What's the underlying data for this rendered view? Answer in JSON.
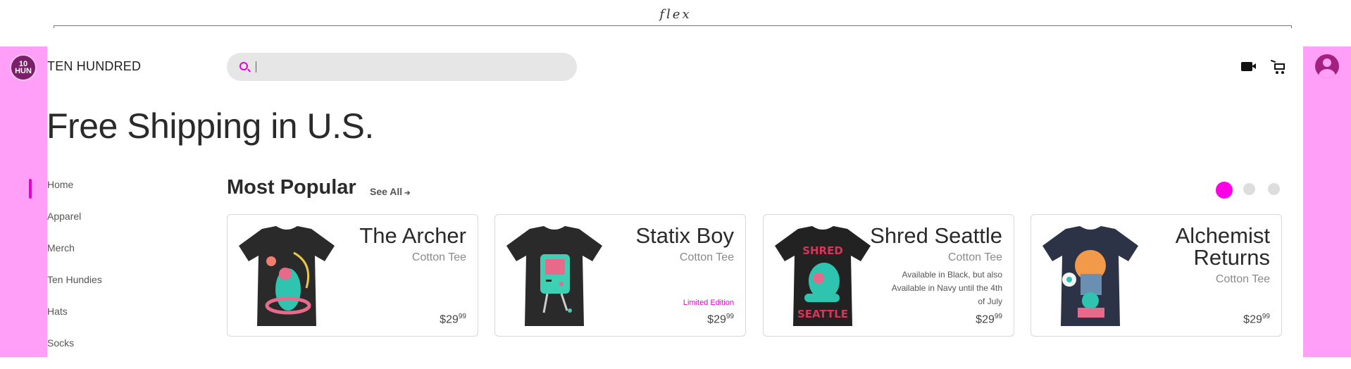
{
  "frame": {
    "label": "flex"
  },
  "brand": {
    "logo_text": "10 HUN",
    "name": "TEN HUNDRED"
  },
  "search": {
    "value": "",
    "placeholder": ""
  },
  "headline": "Free Shipping in U.S.",
  "nav": {
    "items": [
      "Home",
      "Apparel",
      "Merch",
      "Ten Hundies",
      "Hats",
      "Socks"
    ],
    "active": "Home"
  },
  "section": {
    "title": "Most Popular",
    "see_all": "See All",
    "carousel_pages": 3,
    "carousel_active": 1
  },
  "colors": {
    "accent": "#ff00e6",
    "side_panel": "#ff9ff8"
  },
  "icons": {
    "video": "video-icon",
    "cart": "cart-icon",
    "avatar": "avatar-icon",
    "search": "search-icon"
  },
  "products": [
    {
      "name": "The Archer",
      "type": "Cotton Tee",
      "note": "",
      "badge": "",
      "price_main": "$29",
      "price_cents": "99",
      "shirt_color": "#2a2a2a"
    },
    {
      "name": "Statix Boy",
      "type": "Cotton Tee",
      "note": "",
      "badge": "Limited Edition",
      "price_main": "$29",
      "price_cents": "99",
      "shirt_color": "#2a2a2a"
    },
    {
      "name": "Shred Seattle",
      "type": "Cotton Tee",
      "note": "Available in Black, but also Available in Navy until the 4th of July",
      "badge": "",
      "price_main": "$29",
      "price_cents": "99",
      "shirt_color": "#222222"
    },
    {
      "name": "Alchemist Returns",
      "type": "Cotton Tee",
      "note": "",
      "badge": "",
      "price_main": "$29",
      "price_cents": "99",
      "shirt_color": "#2c3347"
    }
  ]
}
